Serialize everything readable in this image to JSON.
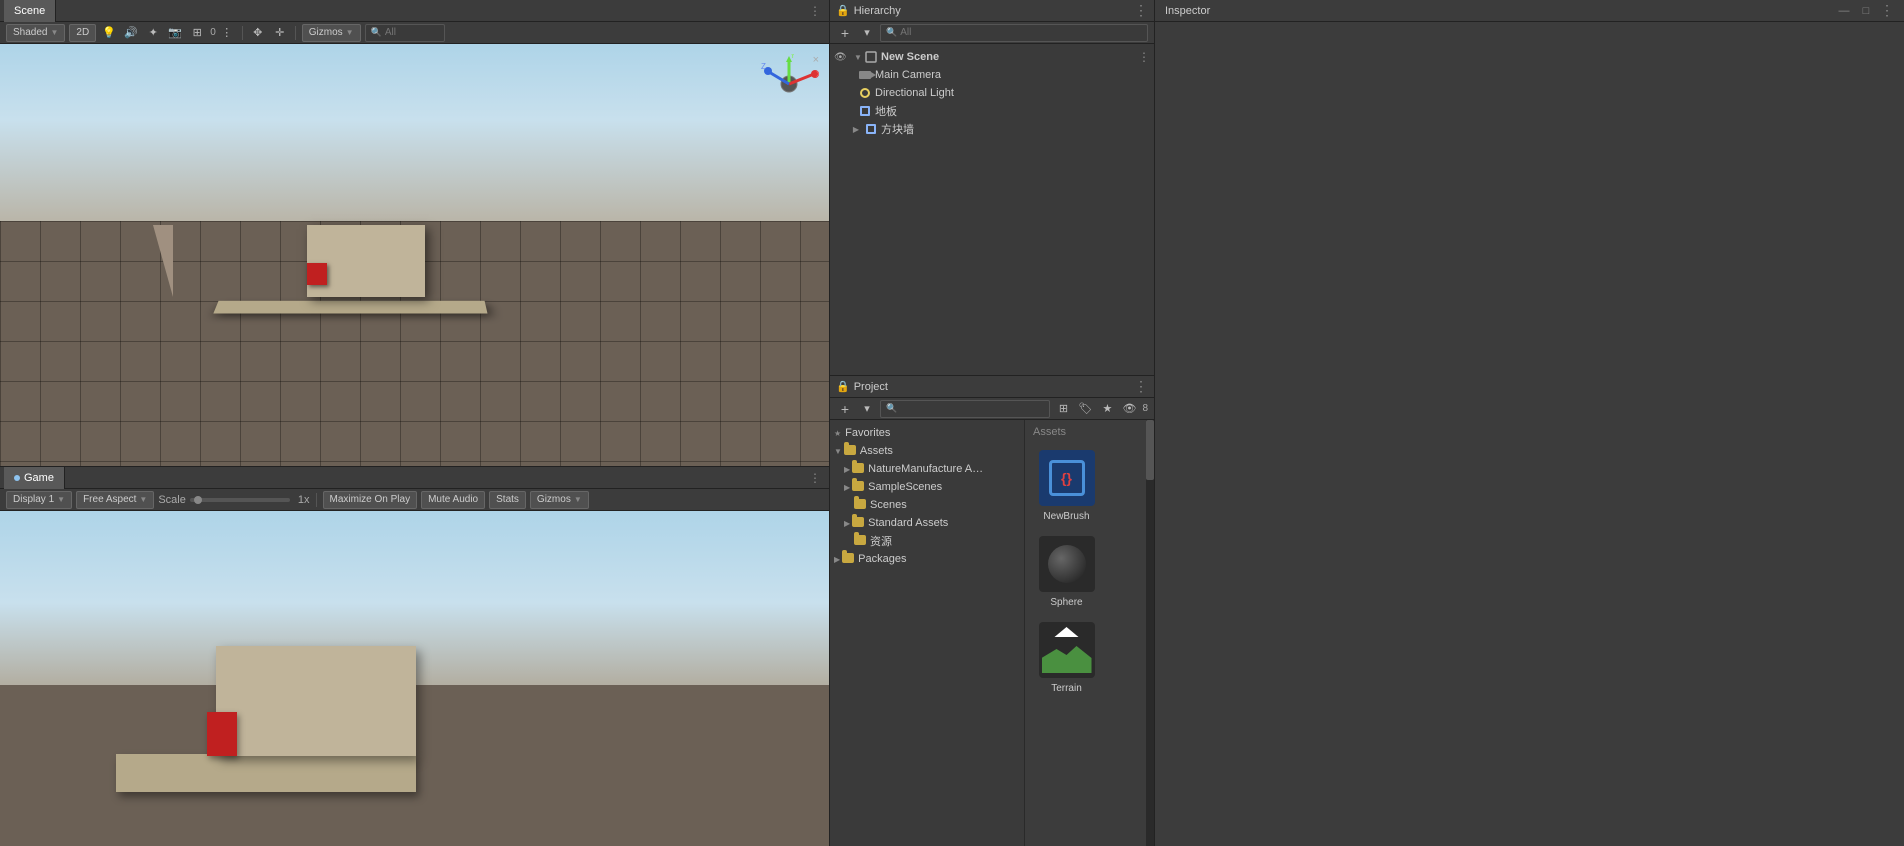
{
  "scene_tab": {
    "label": "Scene",
    "toolbar": {
      "shading_label": "Shaded",
      "view_2d": "2D",
      "gizmos_label": "Gizmos",
      "search_placeholder": "All"
    }
  },
  "game_tab": {
    "label": "Game",
    "toolbar": {
      "display_label": "Display 1",
      "aspect_label": "Free Aspect",
      "scale_label": "Scale",
      "scale_value": "1x",
      "maximize_label": "Maximize On Play",
      "mute_label": "Mute Audio",
      "stats_label": "Stats",
      "gizmos_label": "Gizmos"
    }
  },
  "hierarchy": {
    "panel_title": "Hierarchy",
    "search_placeholder": "All",
    "scene_name": "New Scene",
    "items": [
      {
        "label": "Main Camera",
        "type": "camera",
        "depth": 1
      },
      {
        "label": "Directional Light",
        "type": "light",
        "depth": 1
      },
      {
        "label": "地板",
        "type": "box",
        "depth": 1
      },
      {
        "label": "方块墙",
        "type": "box",
        "depth": 1,
        "has_children": true
      }
    ]
  },
  "inspector": {
    "panel_title": "Inspector"
  },
  "project": {
    "panel_title": "Project",
    "search_placeholder": "",
    "icon_count": "8",
    "favorites_label": "Favorites",
    "tree": [
      {
        "label": "Assets",
        "depth": 0,
        "expanded": true
      },
      {
        "label": "NatureManufacture Asse...",
        "depth": 1,
        "expanded": false
      },
      {
        "label": "SampleScenes",
        "depth": 1,
        "expanded": false
      },
      {
        "label": "Scenes",
        "depth": 2
      },
      {
        "label": "Standard Assets",
        "depth": 1,
        "expanded": false
      },
      {
        "label": "资源",
        "depth": 2
      },
      {
        "label": "Packages",
        "depth": 0
      }
    ],
    "assets_label": "Assets",
    "assets": [
      {
        "name": "NewBrush",
        "type": "newbrush"
      },
      {
        "name": "Sphere",
        "type": "sphere"
      },
      {
        "name": "Terrain",
        "type": "terrain"
      }
    ]
  }
}
